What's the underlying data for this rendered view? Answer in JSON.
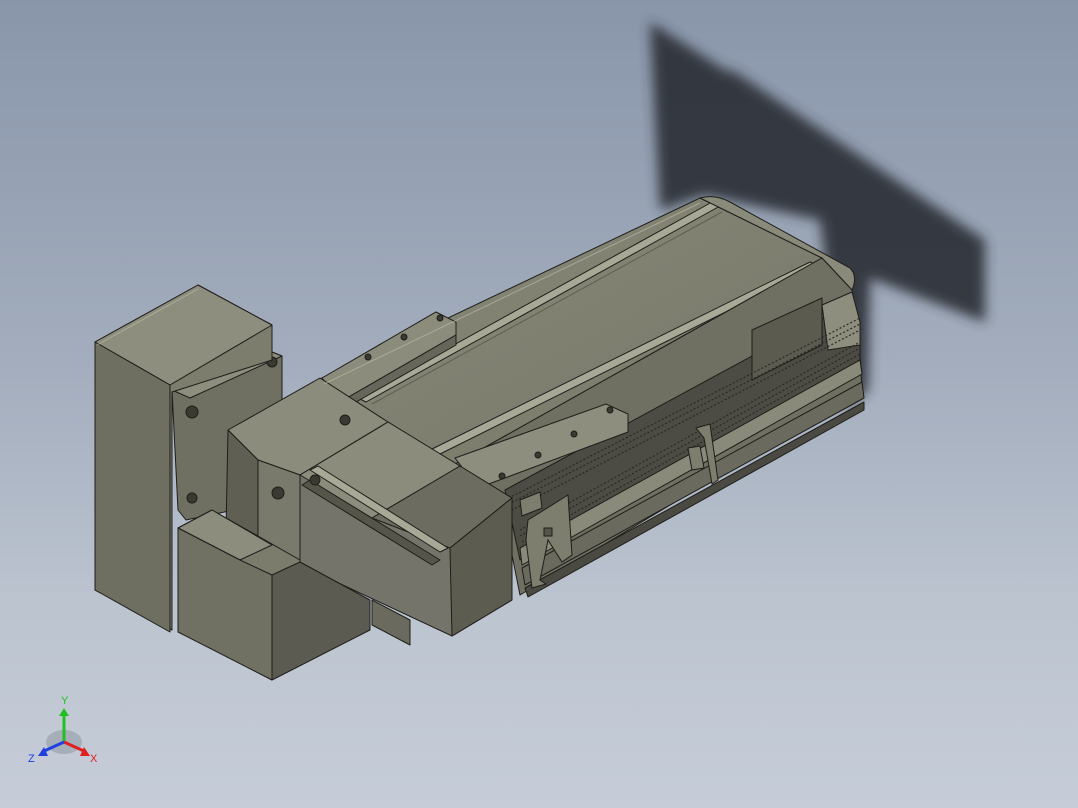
{
  "viewport": {
    "background_top": "#8996aa",
    "background_bottom": "#c6cdd8"
  },
  "model": {
    "body_color": "#7c7c6c",
    "body_light": "#9a9a88",
    "body_dark": "#55554a",
    "edge_color": "#1e1e1a",
    "shadow_color": "#2a2f36"
  },
  "triad": {
    "x_label": "X",
    "y_label": "Y",
    "z_label": "Z",
    "x_color": "#e02020",
    "y_color": "#20c020",
    "z_color": "#2040e0"
  }
}
